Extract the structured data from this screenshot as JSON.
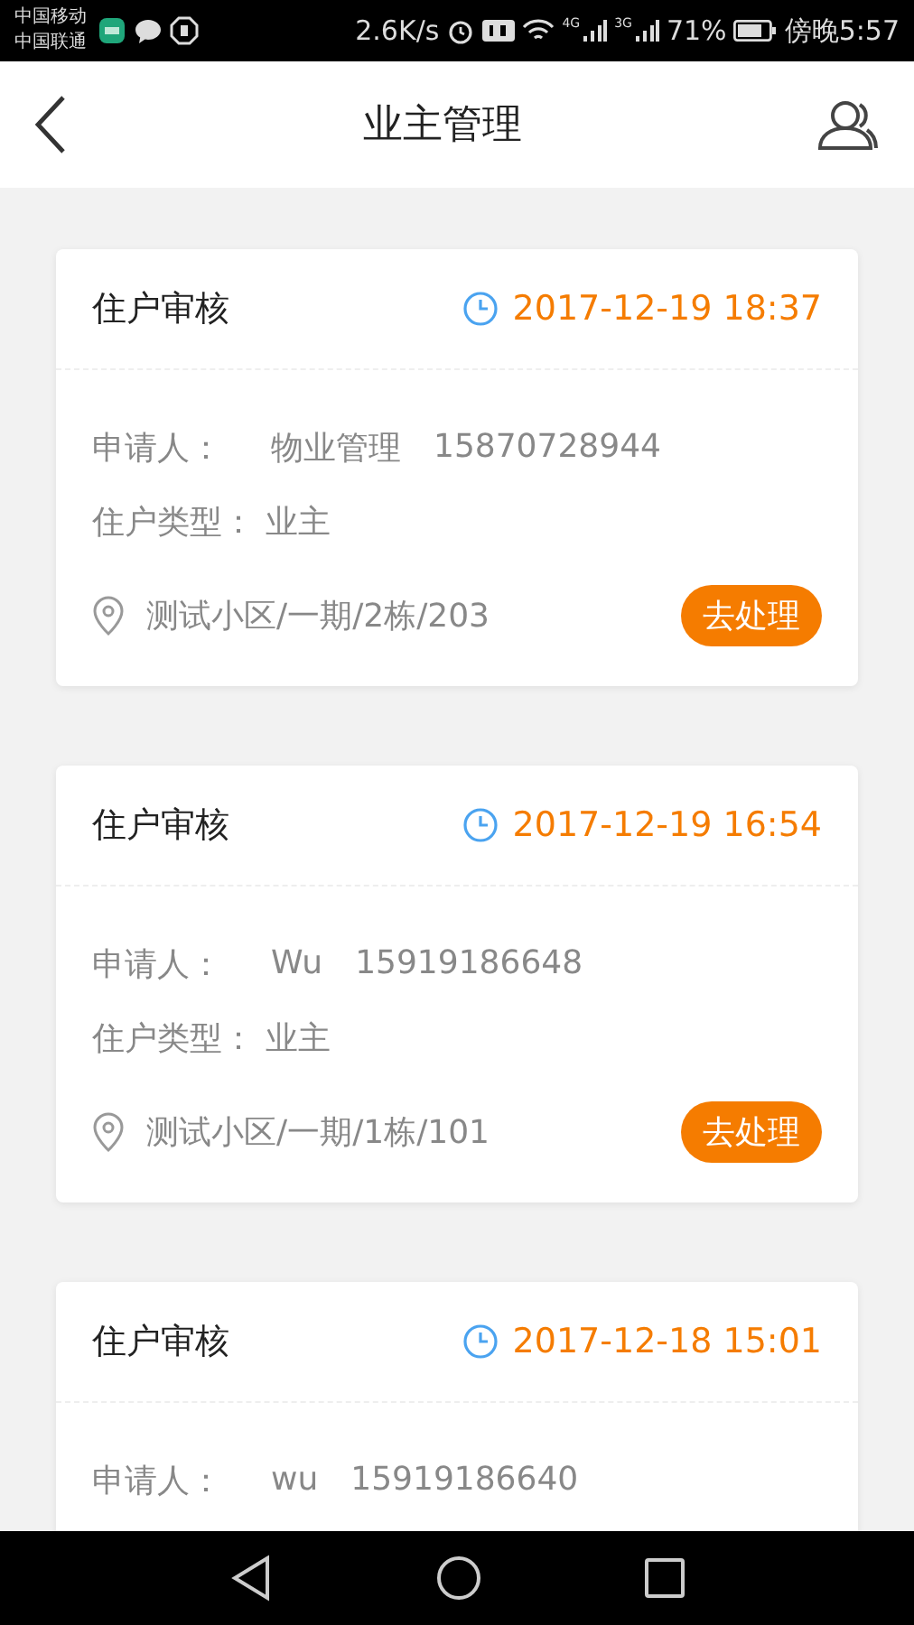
{
  "status_bar": {
    "carriers": [
      "中国移动",
      "中国联通"
    ],
    "speed": "2.6K/s",
    "network_1": "4G",
    "network_2": "3G",
    "battery": "71%",
    "time": "傍晚5:57"
  },
  "header": {
    "title": "业主管理"
  },
  "cards": [
    {
      "title": "住户审核",
      "time": "2017-12-19 18:37",
      "applicant_label": "申请人：",
      "applicant_name": "物业管理",
      "applicant_phone": "15870728944",
      "type_label": "住户类型：",
      "type_value": "业主",
      "address": "测试小区/一期/2栋/203",
      "action": "去处理"
    },
    {
      "title": "住户审核",
      "time": "2017-12-19 16:54",
      "applicant_label": "申请人：",
      "applicant_name": "Wu",
      "applicant_phone": "15919186648",
      "type_label": "住户类型：",
      "type_value": "业主",
      "address": "测试小区/一期/1栋/101",
      "action": "去处理"
    },
    {
      "title": "住户审核",
      "time": "2017-12-18 15:01",
      "applicant_label": "申请人：",
      "applicant_name": "wu",
      "applicant_phone": "15919186640"
    }
  ]
}
